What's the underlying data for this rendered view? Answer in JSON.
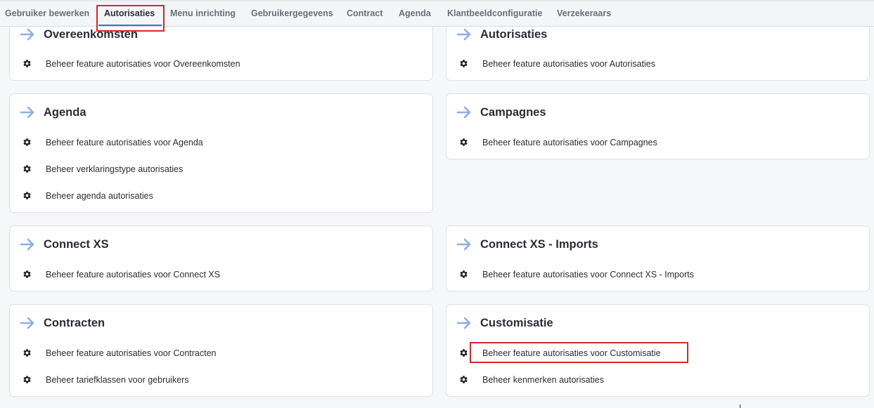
{
  "tabs": [
    {
      "label": "Gebruiker bewerken",
      "active": false
    },
    {
      "label": "Autorisaties",
      "active": true
    },
    {
      "label": "Menu inrichting",
      "active": false
    },
    {
      "label": "Gebruikergegevens",
      "active": false
    },
    {
      "label": "Contract",
      "active": false
    },
    {
      "label": "Agenda",
      "active": false
    },
    {
      "label": "Klantbeeldconfiguratie",
      "active": false
    },
    {
      "label": "Verzekeraars",
      "active": false
    }
  ],
  "colors": {
    "accent": "#3b6fd8",
    "arrow": "#8eaee6",
    "highlight": "#d9262a"
  },
  "icons": {
    "section": "arrow-right-icon",
    "item": "gear-icon"
  },
  "sections": [
    {
      "title": "Overeenkomsten",
      "items": [
        "Beheer feature autorisaties voor Overeenkomsten"
      ]
    },
    {
      "title": "Autorisaties",
      "items": [
        "Beheer feature autorisaties voor Autorisaties"
      ]
    },
    {
      "title": "Agenda",
      "items": [
        "Beheer feature autorisaties voor Agenda",
        "Beheer verklaringstype autorisaties",
        "Beheer agenda autorisaties"
      ]
    },
    {
      "title": "Campagnes",
      "items": [
        "Beheer feature autorisaties voor Campagnes"
      ]
    },
    {
      "title": "Connect XS",
      "items": [
        "Beheer feature autorisaties voor Connect XS"
      ]
    },
    {
      "title": "Connect XS - Imports",
      "items": [
        "Beheer feature autorisaties voor Connect XS - Imports"
      ]
    },
    {
      "title": "Contracten",
      "items": [
        "Beheer feature autorisaties voor Contracten",
        "Beheer tariefklassen voor gebruikers"
      ]
    },
    {
      "title": "Customisatie",
      "items": [
        "Beheer feature autorisaties voor Customisatie",
        "Beheer kenmerken autorisaties"
      ]
    }
  ]
}
